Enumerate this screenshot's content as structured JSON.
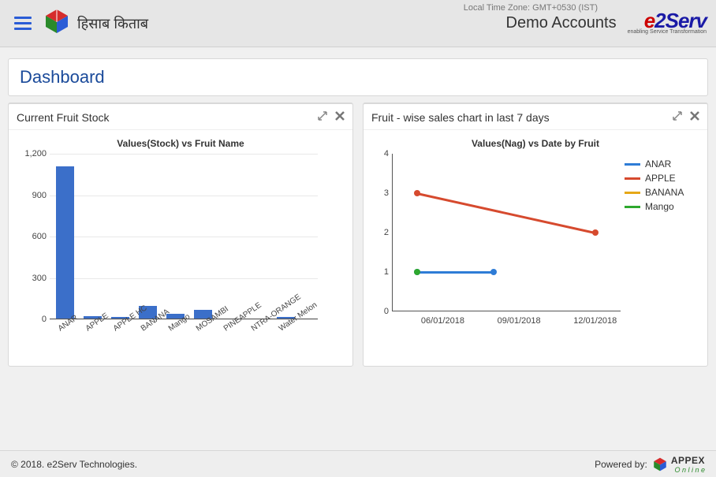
{
  "header": {
    "brand_text": "हिसाब किताब",
    "timezone": "Local Time Zone: GMT+0530 (IST)",
    "account_name": "Demo Accounts",
    "e2serv_tagline": "enabling Service Transformation"
  },
  "page_title": "Dashboard",
  "panels": {
    "stock": {
      "title": "Current Fruit Stock"
    },
    "sales": {
      "title": "Fruit - wise sales chart in last 7 days"
    }
  },
  "footer": {
    "copyright": "© 2018. e2Serv Technologies.",
    "powered_by": "Powered by:",
    "appex_main": "APPEX",
    "appex_sub": "O n l i n e"
  },
  "chart_data": [
    {
      "id": "stock_bar",
      "type": "bar",
      "title": "Values(Stock) vs Fruit Name",
      "xlabel": "",
      "ylabel": "",
      "ylim": [
        0,
        1200
      ],
      "yticks": [
        0,
        300,
        600,
        900,
        1200
      ],
      "categories": [
        "ANAR",
        "APPLE",
        "APPLE HC",
        "BANANA",
        "Mango",
        "MOSAMBI",
        "PINEAPPLE",
        "NTRA-ORANGE",
        "Water Melon"
      ],
      "values": [
        1110,
        25,
        20,
        95,
        40,
        70,
        6,
        4,
        20
      ],
      "color": "#3b6fc9"
    },
    {
      "id": "sales_line",
      "type": "line",
      "title": "Values(Nag) vs Date by Fruit",
      "xlabel": "",
      "ylabel": "",
      "ylim": [
        0,
        4
      ],
      "yticks": [
        0,
        1,
        2,
        3,
        4
      ],
      "x": [
        "06/01/2018",
        "09/01/2018",
        "12/01/2018"
      ],
      "x_ticklabels": [
        "06/01/2018",
        "09/01/2018",
        "12/01/2018"
      ],
      "legend_position": "right",
      "series": [
        {
          "name": "ANAR",
          "color": "#2e7cd6",
          "points": [
            {
              "x": "05/01/2018",
              "y": 1
            },
            {
              "x": "08/01/2018",
              "y": 1
            }
          ]
        },
        {
          "name": "APPLE",
          "color": "#d64a2e",
          "points": [
            {
              "x": "05/01/2018",
              "y": 3
            },
            {
              "x": "12/01/2018",
              "y": 2
            }
          ]
        },
        {
          "name": "BANANA",
          "color": "#e6a817",
          "points": []
        },
        {
          "name": "Mango",
          "color": "#2ea82e",
          "points": [
            {
              "x": "05/01/2018",
              "y": 1
            }
          ]
        }
      ]
    }
  ]
}
